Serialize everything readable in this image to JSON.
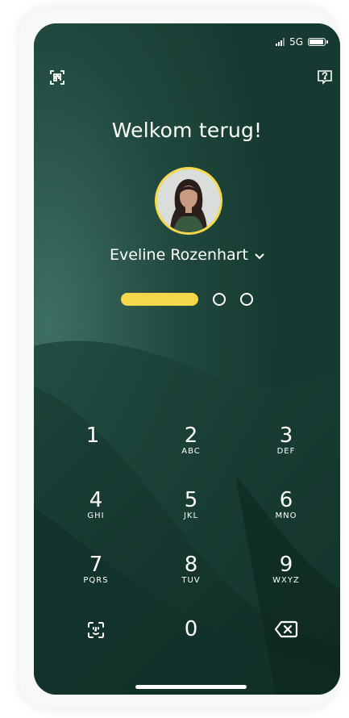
{
  "status_bar": {
    "network": "5G",
    "signal_icon": "signal-bars-icon",
    "battery_icon": "battery-icon"
  },
  "header": {
    "left_icon": "scan-qr-icon",
    "right_icon": "help-chat-icon"
  },
  "welcome": {
    "title": "Welkom terug!"
  },
  "user": {
    "name": "Eveline Rozenhart",
    "dropdown_icon": "chevron-down-icon",
    "avatar_icon": "avatar"
  },
  "pin": {
    "entered": 1,
    "total": 3
  },
  "keypad": {
    "keys": [
      {
        "digit": "1",
        "letters": ""
      },
      {
        "digit": "2",
        "letters": "ABC"
      },
      {
        "digit": "3",
        "letters": "DEF"
      },
      {
        "digit": "4",
        "letters": "GHI"
      },
      {
        "digit": "5",
        "letters": "JKL"
      },
      {
        "digit": "6",
        "letters": "MNO"
      },
      {
        "digit": "7",
        "letters": "PQRS"
      },
      {
        "digit": "8",
        "letters": "TUV"
      },
      {
        "digit": "9",
        "letters": "WXYZ"
      },
      {
        "digit": "0",
        "letters": ""
      }
    ],
    "face_id_icon": "face-id-icon",
    "backspace_icon": "backspace-icon"
  },
  "colors": {
    "background": "#173f36",
    "accent_yellow": "#f4d84a",
    "text": "#ffffff"
  }
}
